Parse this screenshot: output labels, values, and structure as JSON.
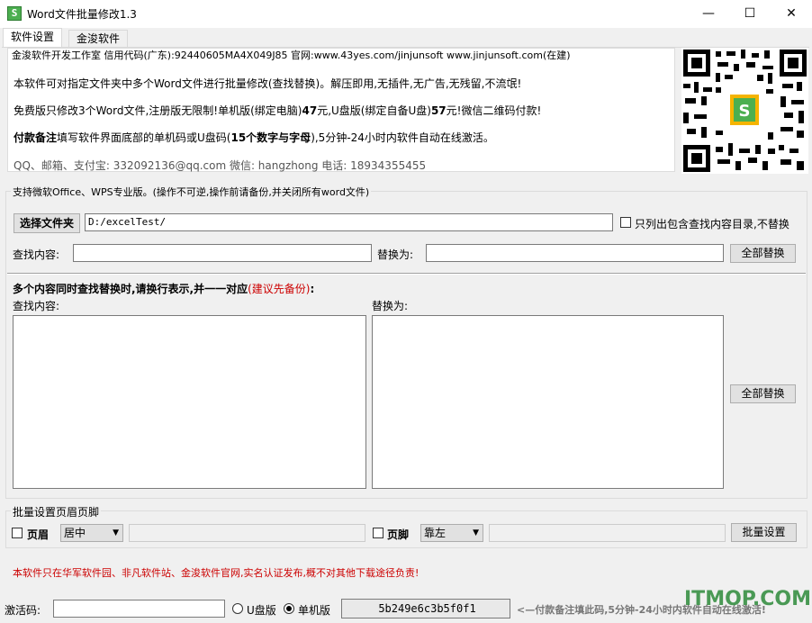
{
  "window": {
    "title": "Word文件批量修改1.3",
    "icon_text": "S",
    "min_glyph": "—",
    "max_glyph": "☐",
    "close_glyph": "✕"
  },
  "tabs": [
    {
      "label": "软件设置",
      "active": true
    },
    {
      "label": "金浚软件",
      "active": false
    }
  ],
  "info": {
    "line1": "金浚软件开发工作室 信用代码(广东):92440605MA4X049J85 官网:www.43yes.com/jinjunsoft  www.jinjunsoft.com(在建)",
    "line2": "本软件可对指定文件夹中多个Word文件进行批量修改(查找替换)。解压即用,无插件,无广告,无残留,不流氓!",
    "line3_a": "免费版只修改3个Word文件,注册版无限制!单机版(绑定电脑)",
    "line3_b": "47",
    "line3_c": "元,U盘版(绑定自备U盘)",
    "line3_d": "57",
    "line3_e": "元!微信二维码付款!",
    "line4_a": "付款备注",
    "line4_b": "填写软件界面底部的单机码或U盘码(",
    "line4_c": "15个数字与字母",
    "line4_d": "),5分钟-24小时内软件自动在线激活。",
    "line5": "QQ、邮箱、支付宝: 332092136@qq.com    微信: hangzhong    电话: 18934355455"
  },
  "section1": {
    "legend": "支持微软Office、WPS专业版。(操作不可逆,操作前请备份,并关闭所有word文件)",
    "choose_folder": "选择文件夹",
    "folder_path": "D:/excelTest/",
    "only_list_label": "只列出包含查找内容目录,不替换",
    "find_label": "查找内容:",
    "replace_label": "替换为:",
    "replace_all": "全部替换",
    "multi_heading_a": "多个内容同时查找替换时,请换行表示,并一一对应",
    "multi_heading_b": "(建议先备份)",
    "multi_heading_c": ":",
    "find_area_label": "查找内容:",
    "replace_area_label": "替换为:",
    "replace_all_2": "全部替换"
  },
  "section2": {
    "legend": "批量设置页眉页脚",
    "header_label": "页眉",
    "header_align": "居中",
    "footer_label": "页脚",
    "footer_align": "靠左",
    "batch_button": "批量设置"
  },
  "notice": "本软件只在华军软件园、非凡软件站、金浚软件官网,实名认证发布,概不对其他下载途径负责!",
  "activation": {
    "label": "激活码:",
    "usb_label": "U盘版",
    "pc_label": "单机版",
    "pc_selected": true,
    "machine_code": "5b249e6c3b5f0f1",
    "hint": "<—付款备注填此码,5分钟-24小时内软件自动在线激活!"
  },
  "watermark": "ITMOP.COM",
  "colors": {
    "notice_red": "#cc0000",
    "watermark_green": "#2e8b3a"
  }
}
